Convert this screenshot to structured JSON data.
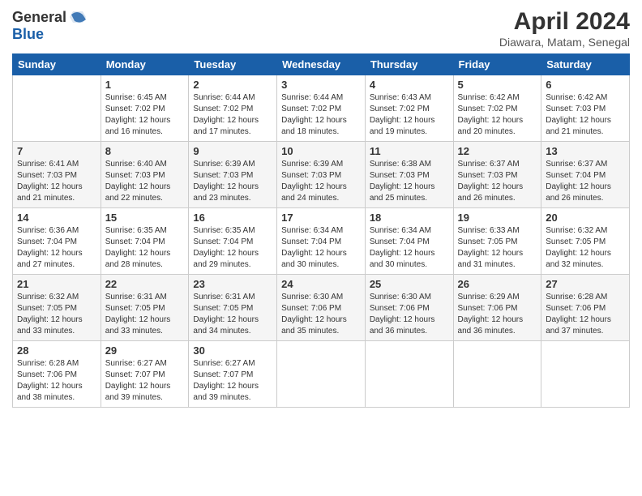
{
  "header": {
    "logo_general": "General",
    "logo_blue": "Blue",
    "title": "April 2024",
    "location": "Diawara, Matam, Senegal"
  },
  "days_of_week": [
    "Sunday",
    "Monday",
    "Tuesday",
    "Wednesday",
    "Thursday",
    "Friday",
    "Saturday"
  ],
  "weeks": [
    [
      {
        "day": "",
        "detail": ""
      },
      {
        "day": "1",
        "detail": "Sunrise: 6:45 AM\nSunset: 7:02 PM\nDaylight: 12 hours\nand 16 minutes."
      },
      {
        "day": "2",
        "detail": "Sunrise: 6:44 AM\nSunset: 7:02 PM\nDaylight: 12 hours\nand 17 minutes."
      },
      {
        "day": "3",
        "detail": "Sunrise: 6:44 AM\nSunset: 7:02 PM\nDaylight: 12 hours\nand 18 minutes."
      },
      {
        "day": "4",
        "detail": "Sunrise: 6:43 AM\nSunset: 7:02 PM\nDaylight: 12 hours\nand 19 minutes."
      },
      {
        "day": "5",
        "detail": "Sunrise: 6:42 AM\nSunset: 7:02 PM\nDaylight: 12 hours\nand 20 minutes."
      },
      {
        "day": "6",
        "detail": "Sunrise: 6:42 AM\nSunset: 7:03 PM\nDaylight: 12 hours\nand 21 minutes."
      }
    ],
    [
      {
        "day": "7",
        "detail": "Sunrise: 6:41 AM\nSunset: 7:03 PM\nDaylight: 12 hours\nand 21 minutes."
      },
      {
        "day": "8",
        "detail": "Sunrise: 6:40 AM\nSunset: 7:03 PM\nDaylight: 12 hours\nand 22 minutes."
      },
      {
        "day": "9",
        "detail": "Sunrise: 6:39 AM\nSunset: 7:03 PM\nDaylight: 12 hours\nand 23 minutes."
      },
      {
        "day": "10",
        "detail": "Sunrise: 6:39 AM\nSunset: 7:03 PM\nDaylight: 12 hours\nand 24 minutes."
      },
      {
        "day": "11",
        "detail": "Sunrise: 6:38 AM\nSunset: 7:03 PM\nDaylight: 12 hours\nand 25 minutes."
      },
      {
        "day": "12",
        "detail": "Sunrise: 6:37 AM\nSunset: 7:03 PM\nDaylight: 12 hours\nand 26 minutes."
      },
      {
        "day": "13",
        "detail": "Sunrise: 6:37 AM\nSunset: 7:04 PM\nDaylight: 12 hours\nand 26 minutes."
      }
    ],
    [
      {
        "day": "14",
        "detail": "Sunrise: 6:36 AM\nSunset: 7:04 PM\nDaylight: 12 hours\nand 27 minutes."
      },
      {
        "day": "15",
        "detail": "Sunrise: 6:35 AM\nSunset: 7:04 PM\nDaylight: 12 hours\nand 28 minutes."
      },
      {
        "day": "16",
        "detail": "Sunrise: 6:35 AM\nSunset: 7:04 PM\nDaylight: 12 hours\nand 29 minutes."
      },
      {
        "day": "17",
        "detail": "Sunrise: 6:34 AM\nSunset: 7:04 PM\nDaylight: 12 hours\nand 30 minutes."
      },
      {
        "day": "18",
        "detail": "Sunrise: 6:34 AM\nSunset: 7:04 PM\nDaylight: 12 hours\nand 30 minutes."
      },
      {
        "day": "19",
        "detail": "Sunrise: 6:33 AM\nSunset: 7:05 PM\nDaylight: 12 hours\nand 31 minutes."
      },
      {
        "day": "20",
        "detail": "Sunrise: 6:32 AM\nSunset: 7:05 PM\nDaylight: 12 hours\nand 32 minutes."
      }
    ],
    [
      {
        "day": "21",
        "detail": "Sunrise: 6:32 AM\nSunset: 7:05 PM\nDaylight: 12 hours\nand 33 minutes."
      },
      {
        "day": "22",
        "detail": "Sunrise: 6:31 AM\nSunset: 7:05 PM\nDaylight: 12 hours\nand 33 minutes."
      },
      {
        "day": "23",
        "detail": "Sunrise: 6:31 AM\nSunset: 7:05 PM\nDaylight: 12 hours\nand 34 minutes."
      },
      {
        "day": "24",
        "detail": "Sunrise: 6:30 AM\nSunset: 7:06 PM\nDaylight: 12 hours\nand 35 minutes."
      },
      {
        "day": "25",
        "detail": "Sunrise: 6:30 AM\nSunset: 7:06 PM\nDaylight: 12 hours\nand 36 minutes."
      },
      {
        "day": "26",
        "detail": "Sunrise: 6:29 AM\nSunset: 7:06 PM\nDaylight: 12 hours\nand 36 minutes."
      },
      {
        "day": "27",
        "detail": "Sunrise: 6:28 AM\nSunset: 7:06 PM\nDaylight: 12 hours\nand 37 minutes."
      }
    ],
    [
      {
        "day": "28",
        "detail": "Sunrise: 6:28 AM\nSunset: 7:06 PM\nDaylight: 12 hours\nand 38 minutes."
      },
      {
        "day": "29",
        "detail": "Sunrise: 6:27 AM\nSunset: 7:07 PM\nDaylight: 12 hours\nand 39 minutes."
      },
      {
        "day": "30",
        "detail": "Sunrise: 6:27 AM\nSunset: 7:07 PM\nDaylight: 12 hours\nand 39 minutes."
      },
      {
        "day": "",
        "detail": ""
      },
      {
        "day": "",
        "detail": ""
      },
      {
        "day": "",
        "detail": ""
      },
      {
        "day": "",
        "detail": ""
      }
    ]
  ]
}
